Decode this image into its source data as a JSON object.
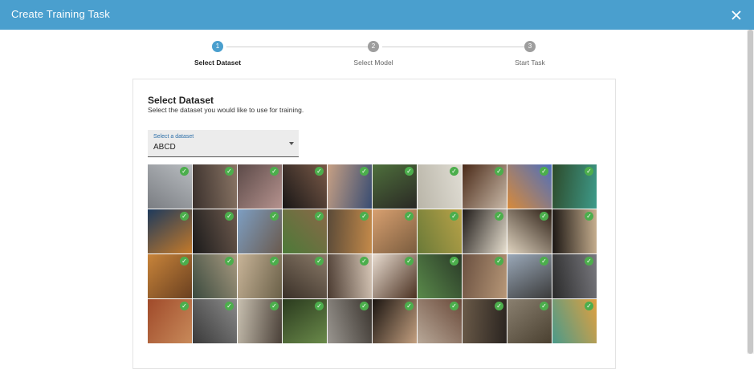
{
  "header": {
    "title": "Create Training Task"
  },
  "stepper": {
    "steps": [
      {
        "number": "1",
        "label": "Select Dataset",
        "active": true
      },
      {
        "number": "2",
        "label": "Select Model",
        "active": false
      },
      {
        "number": "3",
        "label": "Start Task",
        "active": false
      }
    ]
  },
  "card": {
    "title": "Select Dataset",
    "subtitle": "Select the dataset you would like to use for training.",
    "select": {
      "label": "Select a dataset",
      "value": "ABCD"
    }
  },
  "colors": {
    "header": "#4a9fce",
    "step_active": "#4a9fce",
    "step_inactive": "#9e9e9e",
    "select_accent": "#2b6ea8",
    "check": "#4cae4c"
  },
  "images": {
    "selected_icon": "check-circle-icon",
    "tiles": [
      {
        "colors": [
          "#7a7d82",
          "#b8bcc0"
        ],
        "selected": true
      },
      {
        "colors": [
          "#3a302c",
          "#8a7565"
        ],
        "selected": true
      },
      {
        "colors": [
          "#5c4a48",
          "#b5928e"
        ],
        "selected": true
      },
      {
        "colors": [
          "#181616",
          "#7a5a48"
        ],
        "selected": true
      },
      {
        "colors": [
          "#c7a084",
          "#384c72"
        ],
        "selected": true
      },
      {
        "colors": [
          "#4e6f3c",
          "#2a2824"
        ],
        "selected": true
      },
      {
        "colors": [
          "#b9b5a8",
          "#e0ddd4"
        ],
        "selected": true
      },
      {
        "colors": [
          "#4a2a18",
          "#c9b9a8"
        ],
        "selected": true
      },
      {
        "colors": [
          "#d88a3a",
          "#4e6fbd"
        ],
        "selected": true
      },
      {
        "colors": [
          "#2d4a2a",
          "#3e9b8a"
        ],
        "selected": true
      },
      {
        "colors": [
          "#1e3a5c",
          "#c47a2a"
        ],
        "selected": true
      },
      {
        "colors": [
          "#1a1a1a",
          "#6e5a4e"
        ],
        "selected": true
      },
      {
        "colors": [
          "#7d9ec2",
          "#6a5a4e"
        ],
        "selected": true
      },
      {
        "colors": [
          "#4c7a38",
          "#8a6848"
        ],
        "selected": true
      },
      {
        "colors": [
          "#5a4a38",
          "#c48a4a"
        ],
        "selected": true
      },
      {
        "colors": [
          "#d8a070",
          "#7a5c3e"
        ],
        "selected": true
      },
      {
        "colors": [
          "#6a7a38",
          "#b8a248"
        ],
        "selected": true
      },
      {
        "colors": [
          "#1e1a18",
          "#e8e0d0"
        ],
        "selected": true
      },
      {
        "colors": [
          "#e0d4c0",
          "#2c1e14"
        ],
        "selected": true
      },
      {
        "colors": [
          "#1a1512",
          "#c8b090"
        ],
        "selected": true
      },
      {
        "colors": [
          "#c8843a",
          "#6a4020"
        ],
        "selected": true
      },
      {
        "colors": [
          "#3a4a3e",
          "#a89a80"
        ],
        "selected": true
      },
      {
        "colors": [
          "#c8b498",
          "#6a6048"
        ],
        "selected": true
      },
      {
        "colors": [
          "#3a3028",
          "#8a7a68"
        ],
        "selected": true
      },
      {
        "colors": [
          "#4a3a30",
          "#d8c8b8"
        ],
        "selected": true
      },
      {
        "colors": [
          "#e8dcd0",
          "#4a3020"
        ],
        "selected": true
      },
      {
        "colors": [
          "#5a8a4a",
          "#2a3a28"
        ],
        "selected": true
      },
      {
        "colors": [
          "#6a5040",
          "#b89878"
        ],
        "selected": true
      },
      {
        "colors": [
          "#9aa8b8",
          "#3a3a3a"
        ],
        "selected": true
      },
      {
        "colors": [
          "#2a2a2a",
          "#7a7a80"
        ],
        "selected": true
      },
      {
        "colors": [
          "#a04a2a",
          "#c88a5a"
        ],
        "selected": true
      },
      {
        "colors": [
          "#3a3a3a",
          "#8a8a8a"
        ],
        "selected": true
      },
      {
        "colors": [
          "#c8c0b0",
          "#4a4038"
        ],
        "selected": true
      },
      {
        "colors": [
          "#2a3a1e",
          "#6a8a4a"
        ],
        "selected": true
      },
      {
        "colors": [
          "#9a9690",
          "#3a342e"
        ],
        "selected": true
      },
      {
        "colors": [
          "#1a1410",
          "#c4a080"
        ],
        "selected": true
      },
      {
        "colors": [
          "#b8a898",
          "#6a4a3a"
        ],
        "selected": true
      },
      {
        "colors": [
          "#6a5a48",
          "#2a2420"
        ],
        "selected": true
      },
      {
        "colors": [
          "#8a8070",
          "#4a4030"
        ],
        "selected": true
      },
      {
        "colors": [
          "#4a9a8a",
          "#e0a040"
        ],
        "selected": true
      }
    ]
  }
}
